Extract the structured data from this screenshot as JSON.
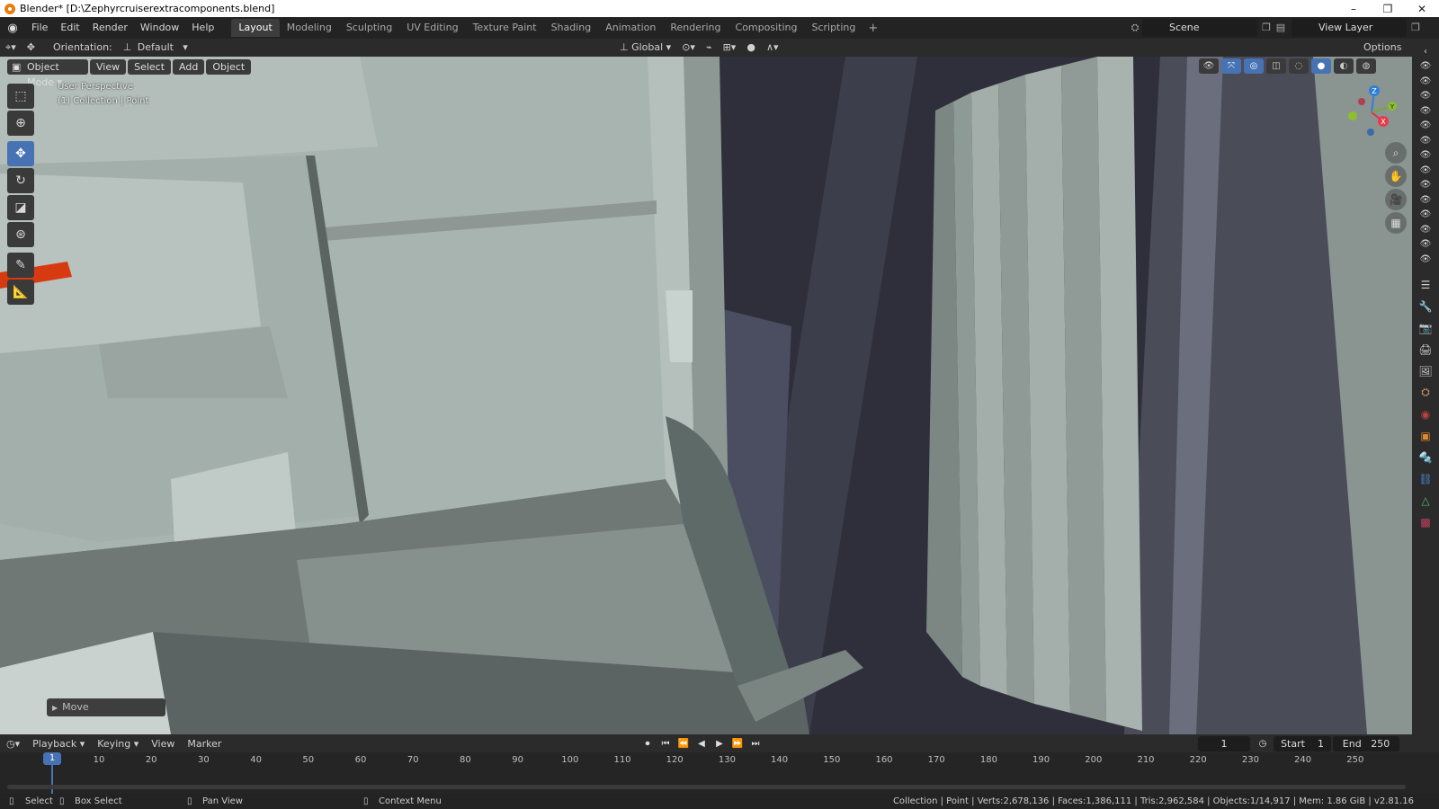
{
  "window": {
    "title": "Blender* [D:\\Zephyrcruiserextracomponents.blend]",
    "controls": [
      "–",
      "❐",
      "✕"
    ]
  },
  "menu": [
    "File",
    "Edit",
    "Render",
    "Window",
    "Help"
  ],
  "workspaces": {
    "tabs": [
      "Layout",
      "Modeling",
      "Sculpting",
      "UV Editing",
      "Texture Paint",
      "Shading",
      "Animation",
      "Rendering",
      "Compositing",
      "Scripting"
    ],
    "active": "Layout",
    "add": "+"
  },
  "scene": {
    "name": "Scene"
  },
  "view_layer": {
    "name": "View Layer"
  },
  "header": {
    "orientation_label": "Orientation:",
    "orientation_value": "Default",
    "transform_orientation": "Global",
    "options_label": "Options"
  },
  "viewport": {
    "mode": "Object Mode",
    "menus": [
      "View",
      "Select",
      "Add",
      "Object"
    ],
    "perspective_text": "User Perspective",
    "collection_text": "(1) Collection | Point",
    "gizmo_axes": {
      "x": "X",
      "y": "Y",
      "z": "Z"
    },
    "last_operator": "Move"
  },
  "timeline": {
    "menus": [
      "Playback",
      "Keying",
      "View",
      "Marker"
    ],
    "current_frame": "1",
    "start_label": "Start",
    "start": "1",
    "end_label": "End",
    "end": "250",
    "ruler": [
      "10",
      "20",
      "30",
      "40",
      "50",
      "60",
      "70",
      "80",
      "90",
      "100",
      "110",
      "120",
      "130",
      "140",
      "150",
      "160",
      "170",
      "180",
      "190",
      "200",
      "210",
      "220",
      "230",
      "240",
      "250"
    ],
    "cursor_label": "1"
  },
  "status": {
    "select": "Select",
    "box_select": "Box Select",
    "pan_view": "Pan View",
    "context_menu": "Context Menu",
    "stats": "Collection | Point | Verts:2,678,136 | Faces:1,386,111 | Tris:2,962,584 | Objects:1/14,917 | Mem: 1.86 GiB | v2.81.16"
  },
  "colors": {
    "accent": "#4772b3",
    "wall_light": "#a9b5b0",
    "wall_dark": "#3a3a45",
    "highlight_red": "#d83a10"
  }
}
